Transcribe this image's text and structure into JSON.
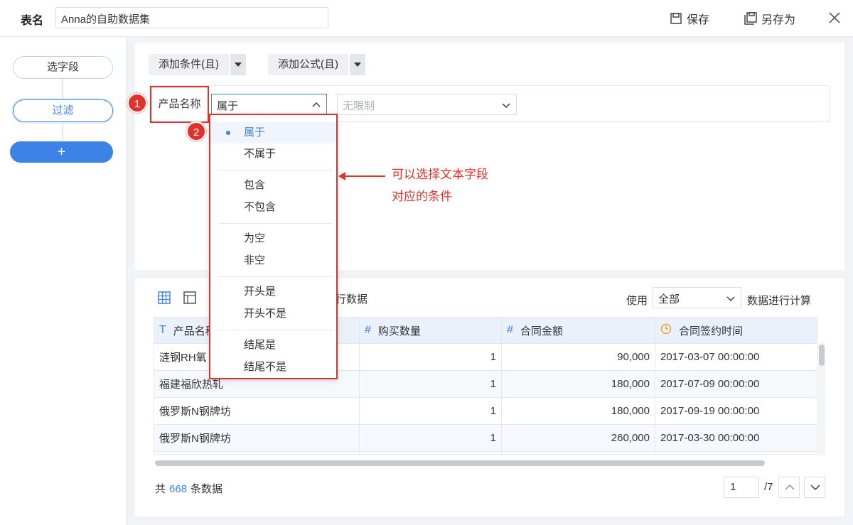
{
  "topbar": {
    "table_label": "表名",
    "table_name": "Anna的自助数据集",
    "save_label": "保存",
    "save_as_label": "另存为"
  },
  "sidebar": {
    "steps": [
      {
        "label": "选字段"
      },
      {
        "label": "过滤"
      },
      {
        "label": "+"
      }
    ]
  },
  "filter": {
    "add_condition_label": "添加条件(且)",
    "add_formula_label": "添加公式(且)",
    "field_name": "产品名称",
    "operator": "属于",
    "value_placeholder": "无限制",
    "badge_1": "1",
    "badge_2": "2"
  },
  "dropdown": {
    "options": [
      "属于",
      "不属于",
      "包含",
      "不包含",
      "为空",
      "非空",
      "开头是",
      "开头不是",
      "结尾是",
      "结尾不是"
    ],
    "selected": "属于"
  },
  "annotation": {
    "line1": "可以选择文本字段",
    "line2": "对应的条件"
  },
  "table": {
    "rows_text_suffix": "行数据",
    "use_label": "使用",
    "use_value": "全部",
    "calc_label": "数据进行计算",
    "columns": [
      {
        "type_icon": "T",
        "label": "产品名称"
      },
      {
        "type_icon": "#",
        "label": "购买数量"
      },
      {
        "type_icon": "#",
        "label": "合同金额"
      },
      {
        "type_icon": "clock",
        "label": "合同签约时间"
      }
    ],
    "rows": [
      [
        "涟钢RH氧",
        "1",
        "90,000",
        "2017-03-07 00:00:00"
      ],
      [
        "福建福欣热轧",
        "1",
        "180,000",
        "2017-07-09 00:00:00"
      ],
      [
        "俄罗斯N钢牌坊",
        "1",
        "180,000",
        "2017-09-19 00:00:00"
      ],
      [
        "俄罗斯N钢牌坊",
        "1",
        "260,000",
        "2017-03-30 00:00:00"
      ]
    ],
    "total_prefix": "共",
    "total_count": "668",
    "total_suffix": "条数据",
    "page_current": "1",
    "page_total": "/7"
  },
  "colors": {
    "accent": "#3d82e6",
    "annotation_red": "#e0312b",
    "clock_icon": "#f0a020"
  }
}
